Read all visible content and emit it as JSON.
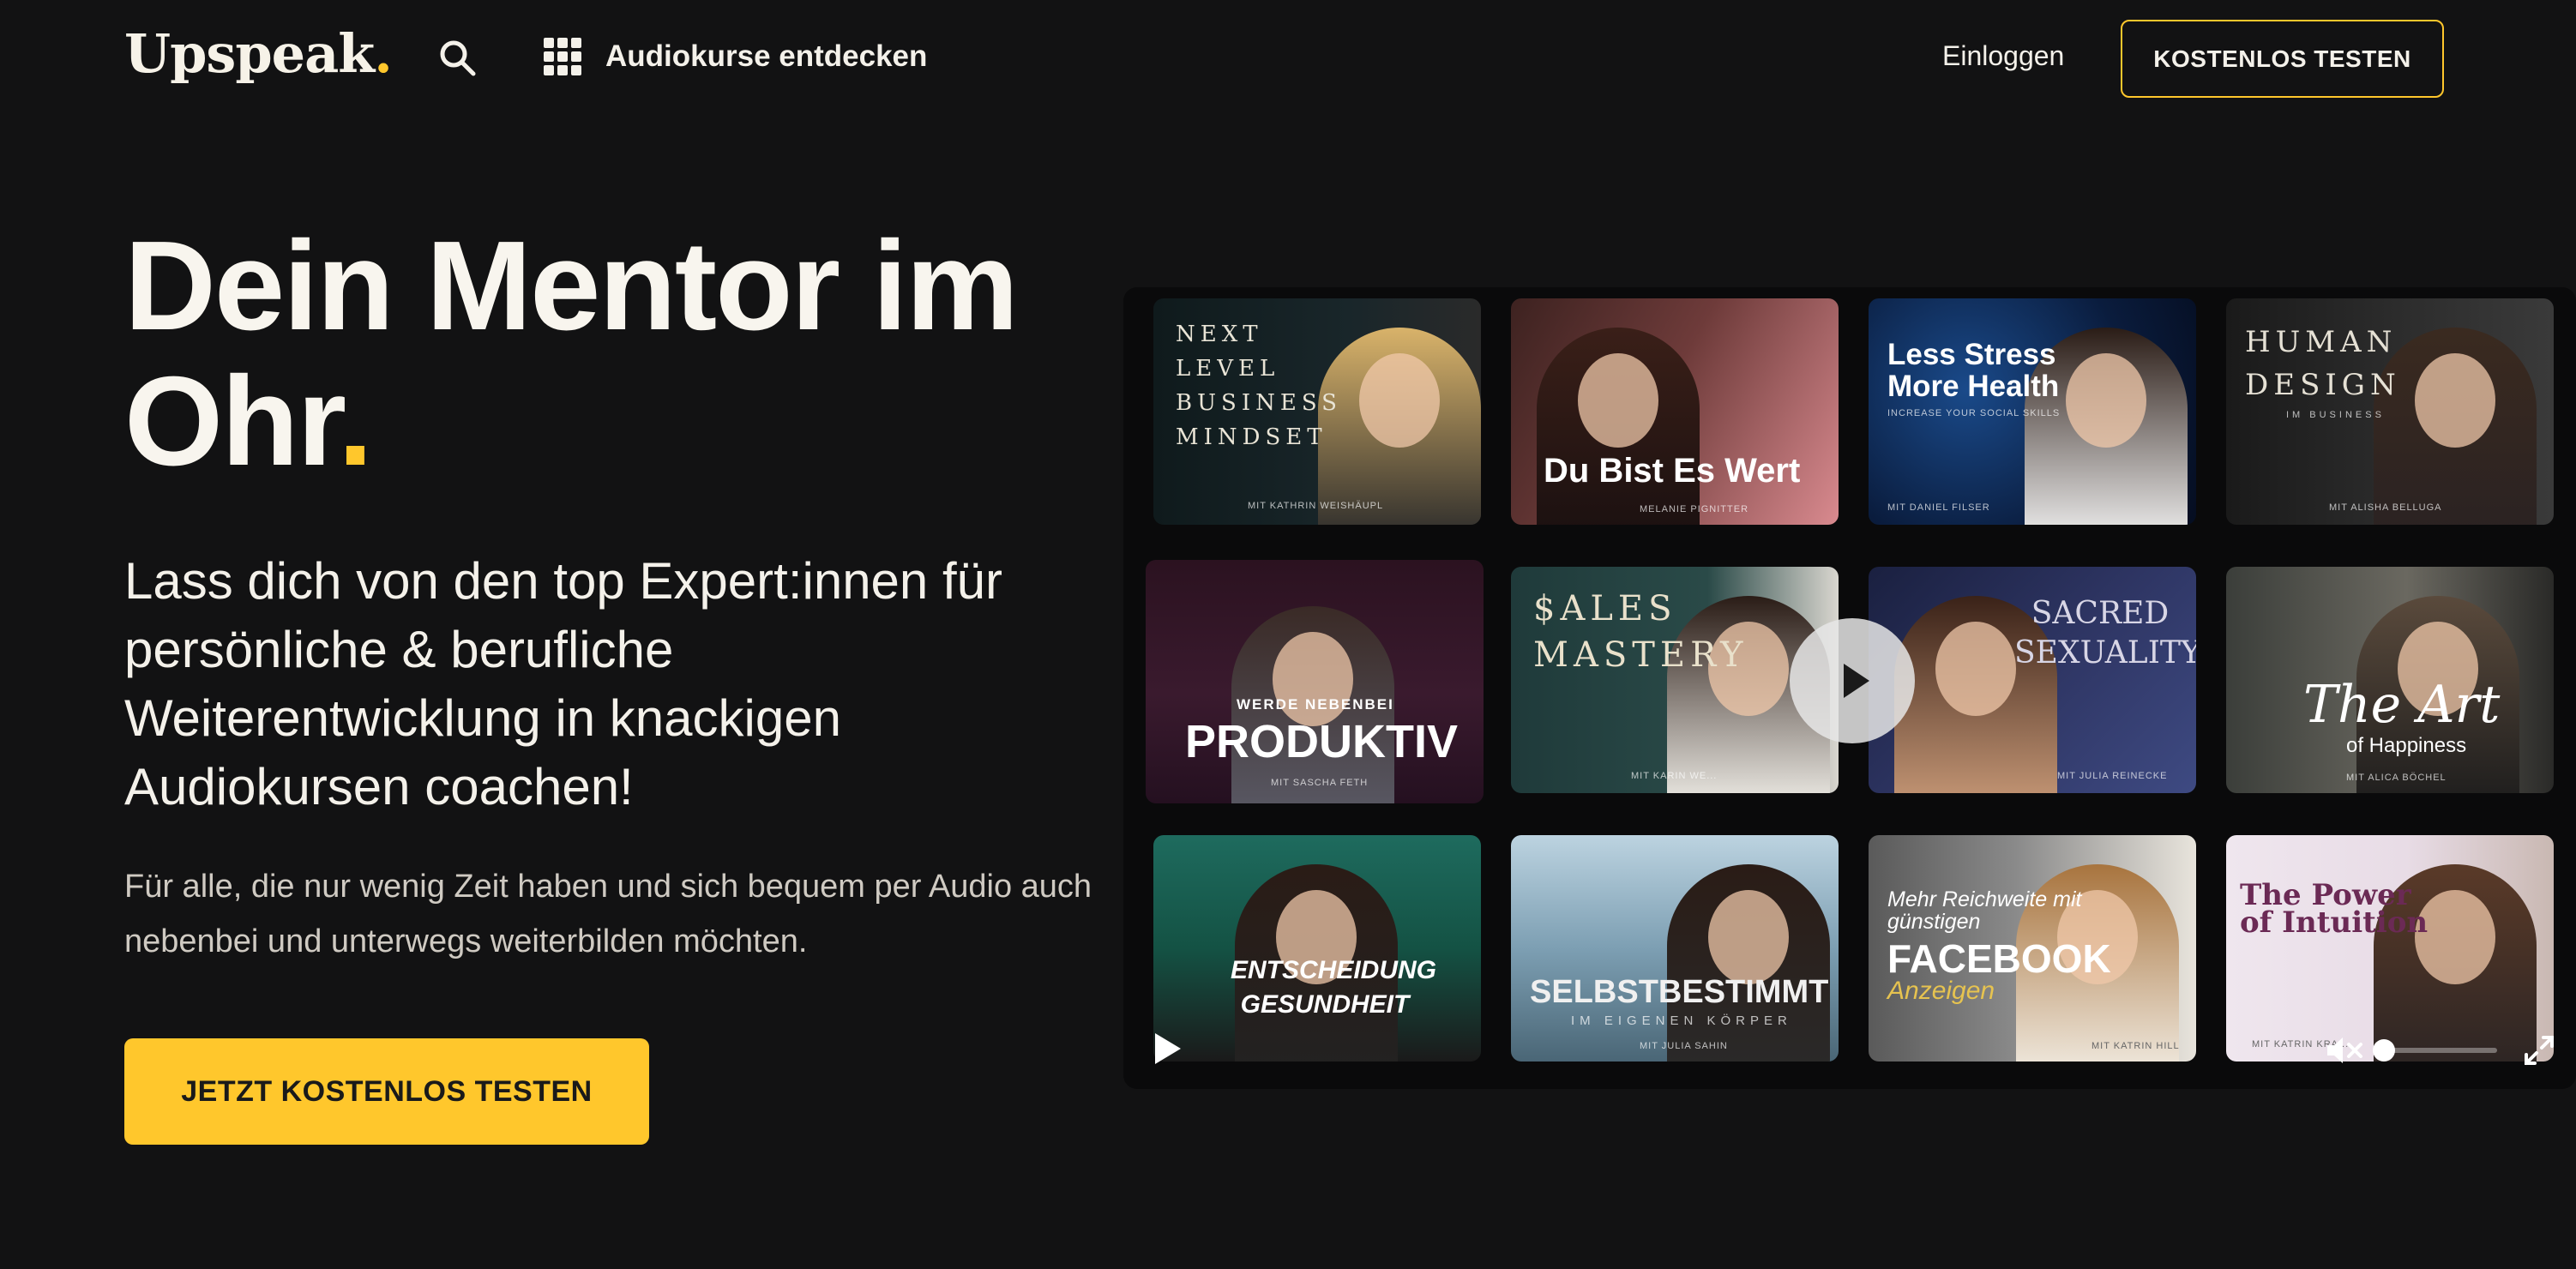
{
  "header": {
    "logo_text": "Upspeak",
    "logo_dot": ".",
    "nav_discover": "Audiokurse entdecken",
    "login": "Einloggen",
    "trial_button": "KOSTENLOS TESTEN"
  },
  "hero": {
    "headline": "Dein Mentor im Ohr",
    "headline_dot": ".",
    "subheadline": "Lass dich von den top Expert:innen für persönliche & berufliche Weiterentwicklung in knackigen Audiokursen coachen!",
    "body": "Für alle, die nur wenig Zeit haben und sich bequem per Audio auch nebenbei und unterwegs weiterbilden möchten.",
    "cta": "JETZT KOSTENLOS TESTEN"
  },
  "courses": [
    {
      "title": "NEXT LEVEL BUSINESS MINDSET",
      "author": "MIT KATHRIN WEISHÄUPL"
    },
    {
      "title": "Du Bist Es Wert",
      "author": "MELANIE PIGNITTER"
    },
    {
      "title": "Less Stress More Health",
      "tagline": "INCREASE YOUR SOCIAL SKILLS",
      "author": "MIT DANIEL FILSER"
    },
    {
      "title": "HUMAN DESIGN",
      "tagline": "IM BUSINESS",
      "author": "MIT ALISHA BELLUGA"
    },
    {
      "kicker": "WERDE NEBENBEI",
      "title": "PRODUKTIV",
      "author": "MIT SASCHA FETH"
    },
    {
      "title": "$ALES MASTERY",
      "author": "MIT KARIN WE..."
    },
    {
      "title": "SACRED SEXUALITY",
      "author": "MIT JULIA REINECKE"
    },
    {
      "title": "The Art",
      "tagline": "of Happiness",
      "author": "MIT ALICA BÖCHEL"
    },
    {
      "title": "ENTSCHEIDUNG GESUNDHEIT",
      "author": ""
    },
    {
      "title": "SELBSTBESTIMMT",
      "tagline": "IM EIGENEN KÖRPER",
      "author": "MIT JULIA SAHIN"
    },
    {
      "kicker": "Mehr Reichweite mit günstigen",
      "title": "FACEBOOK",
      "tagline": "Anzeigen",
      "author": "MIT KATRIN HILL"
    },
    {
      "title": "The Power of Intuition",
      "author": "MIT KATRIN KRA..."
    }
  ],
  "player": {
    "volume_level": 0.0,
    "progress": 0.0
  },
  "colors": {
    "background": "#121213",
    "accent": "#ffc72c",
    "text": "#f4f1ea"
  }
}
